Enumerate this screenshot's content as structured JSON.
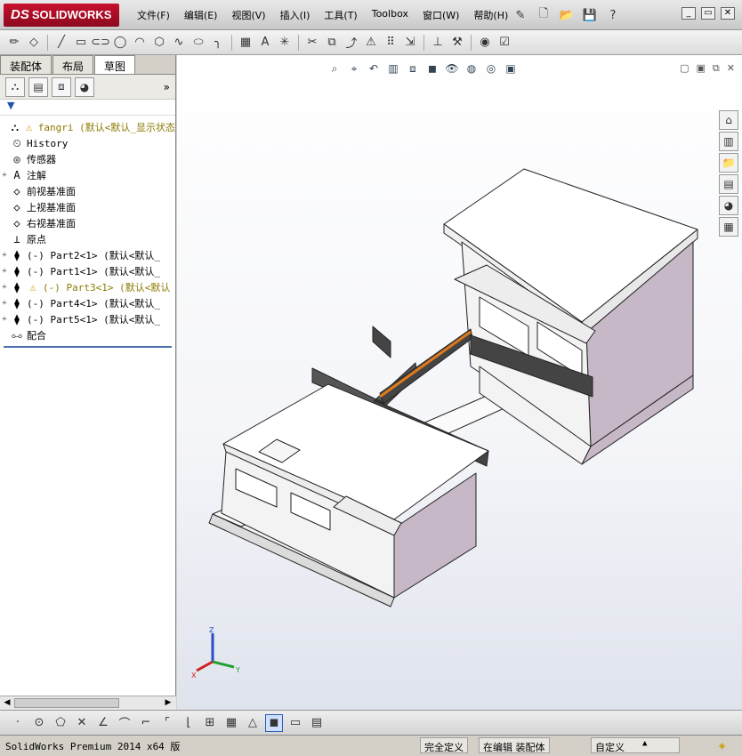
{
  "app": {
    "logo": "SOLIDWORKS",
    "logo_mark": "DS"
  },
  "menu": {
    "items": [
      "文件(F)",
      "编辑(E)",
      "视图(V)",
      "插入(I)",
      "工具(T)",
      "Toolbox",
      "窗口(W)",
      "帮助(H)"
    ]
  },
  "left_panel": {
    "tabs": [
      "装配体",
      "布局",
      "草图"
    ],
    "active_tab": "草图",
    "tree": [
      {
        "label": "fangri  (默认<默认_显示状态",
        "icon": "assembly-icon",
        "warn": true,
        "expand": ""
      },
      {
        "label": "History",
        "icon": "history-icon",
        "warn": false,
        "expand": ""
      },
      {
        "label": "传感器",
        "icon": "sensor-icon",
        "warn": false,
        "expand": ""
      },
      {
        "label": "注解",
        "icon": "annotation-icon",
        "warn": false,
        "expand": "+"
      },
      {
        "label": "前视基准面",
        "icon": "plane-icon",
        "warn": false,
        "expand": ""
      },
      {
        "label": "上视基准面",
        "icon": "plane-icon",
        "warn": false,
        "expand": ""
      },
      {
        "label": "右视基准面",
        "icon": "plane-icon",
        "warn": false,
        "expand": ""
      },
      {
        "label": "原点",
        "icon": "origin-icon",
        "warn": false,
        "expand": ""
      },
      {
        "label": "(-) Part2<1> (默认<默认_",
        "icon": "part-icon",
        "warn": false,
        "expand": "+"
      },
      {
        "label": "(-) Part1<1> (默认<默认_",
        "icon": "part-icon",
        "warn": false,
        "expand": "+"
      },
      {
        "label": "(-) Part3<1> (默认<默认",
        "icon": "part-icon",
        "warn": true,
        "expand": "+"
      },
      {
        "label": "(-) Part4<1> (默认<默认_",
        "icon": "part-icon",
        "warn": false,
        "expand": "+"
      },
      {
        "label": "(-) Part5<1> (默认<默认_",
        "icon": "part-icon",
        "warn": false,
        "expand": "+"
      },
      {
        "label": "配合",
        "icon": "mate-icon",
        "warn": false,
        "expand": ""
      }
    ]
  },
  "status": {
    "product": "SolidWorks Premium 2014 x64 版",
    "definition": "完全定义",
    "editing": "在编辑 装配体",
    "units": "自定义"
  },
  "colors": {
    "logo_red": "#c8102e",
    "wall": "#c7b8c8",
    "railing": "#444444",
    "accent": "#e07a1a"
  }
}
